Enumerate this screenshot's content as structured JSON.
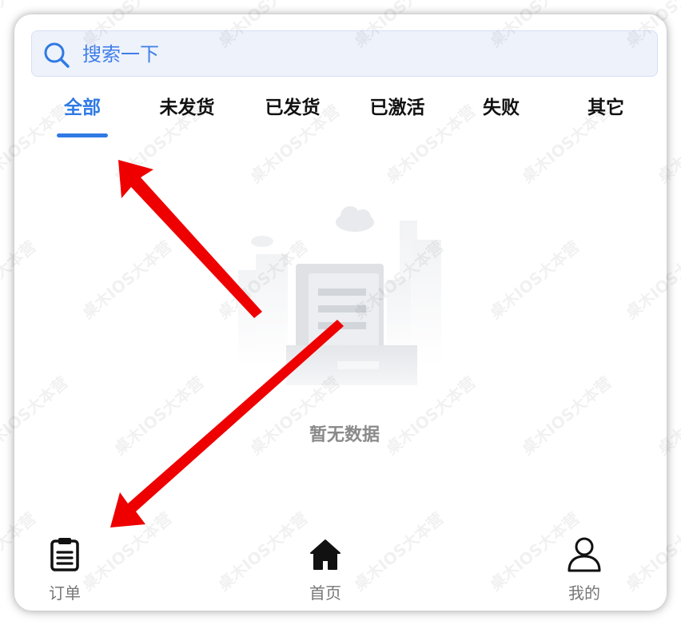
{
  "search": {
    "placeholder": "搜索一下"
  },
  "tabs": [
    {
      "label": "全部",
      "active": true
    },
    {
      "label": "未发货",
      "active": false
    },
    {
      "label": "已发货",
      "active": false
    },
    {
      "label": "已激活",
      "active": false
    },
    {
      "label": "失败",
      "active": false
    },
    {
      "label": "其它",
      "active": false
    }
  ],
  "empty_state": {
    "message": "暂无数据",
    "icon": "empty-document-icon"
  },
  "bottom_nav": [
    {
      "label": "订单",
      "icon": "clipboard-icon"
    },
    {
      "label": "首页",
      "icon": "home-icon"
    },
    {
      "label": "我的",
      "icon": "user-icon"
    }
  ],
  "watermark": {
    "text": "桌木IOS大本营"
  },
  "colors": {
    "accent": "#2f7ae5",
    "annotation": "#ee0000",
    "search_bg": "#eef2fb"
  }
}
